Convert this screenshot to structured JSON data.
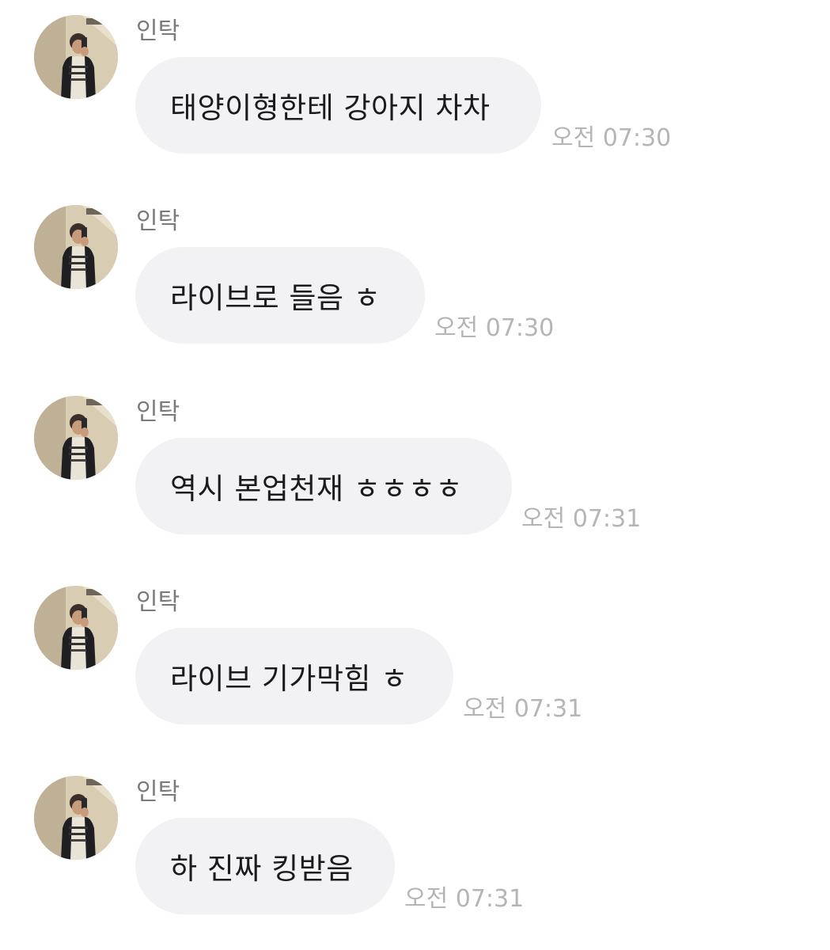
{
  "chat": {
    "messages": [
      {
        "sender": "인탁",
        "text": "태양이형한테 강아지 차차",
        "time": "오전 07:30"
      },
      {
        "sender": "인탁",
        "text": "라이브로 들음 ㅎ",
        "time": "오전 07:30"
      },
      {
        "sender": "인탁",
        "text": "역시 본업천재 ㅎㅎㅎㅎ",
        "time": "오전 07:31"
      },
      {
        "sender": "인탁",
        "text": "라이브 기가막힘 ㅎ",
        "time": "오전 07:31"
      },
      {
        "sender": "인탁",
        "text": "하 진짜 킹받음",
        "time": "오전 07:31"
      }
    ]
  },
  "colors": {
    "background": "#ffffff",
    "bubble": "#f2f2f5",
    "message_text": "#1b1b1b",
    "sender_text": "#7a7a7a",
    "time_text": "#b5b5b8"
  }
}
